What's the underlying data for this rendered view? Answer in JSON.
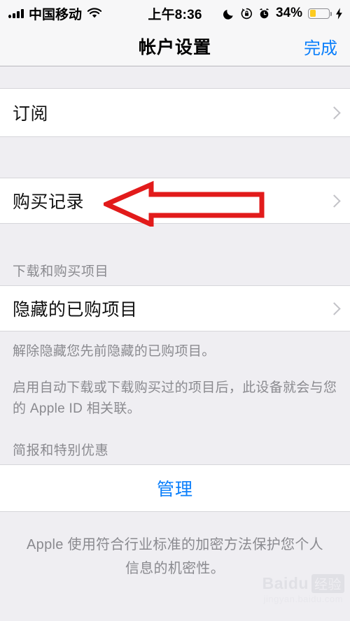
{
  "status_bar": {
    "signal_icon": "cellular-signal-icon",
    "carrier": "中国移动",
    "wifi_icon": "wifi-icon",
    "time": "上午8:36",
    "dnd_icon": "moon-do-not-disturb-icon",
    "rotation_lock_icon": "rotation-lock-icon",
    "alarm_icon": "alarm-clock-icon",
    "battery_percent": "34%",
    "battery_icon": "battery-low-power-icon",
    "charging_icon": "lightning-bolt-icon",
    "battery_level": 34,
    "battery_color": "#fdcb20"
  },
  "nav": {
    "title": "帐户设置",
    "done_label": "完成",
    "accent_color": "#0b7ffb"
  },
  "sections": {
    "subscriptions": {
      "label": "订阅",
      "chevron_icon": "chevron-right-icon"
    },
    "purchase_history": {
      "label": "购买记录",
      "chevron_icon": "chevron-right-icon"
    },
    "downloads": {
      "header": "下载和购买项目",
      "hidden_purchases_label": "隐藏的已购项目",
      "chevron_icon": "chevron-right-icon",
      "footer_line_1": "解除隐藏您先前隐藏的已购项目。",
      "footer_line_2": "启用自动下载或下载购买过的项目后，此设备就会与您的 Apple ID 相关联。"
    },
    "newsletter": {
      "header": "简报和特别优惠",
      "manage_label": "管理"
    },
    "privacy_note": "Apple 使用符合行业标准的加密方法保护您个人信息的机密性。"
  },
  "annotation": {
    "type": "arrow-left-outline",
    "color": "#e21b1b",
    "target": "购买记录"
  },
  "watermark": {
    "brand": "Baidu",
    "suffix": "经验",
    "url": "jingyan.baidu.com"
  }
}
